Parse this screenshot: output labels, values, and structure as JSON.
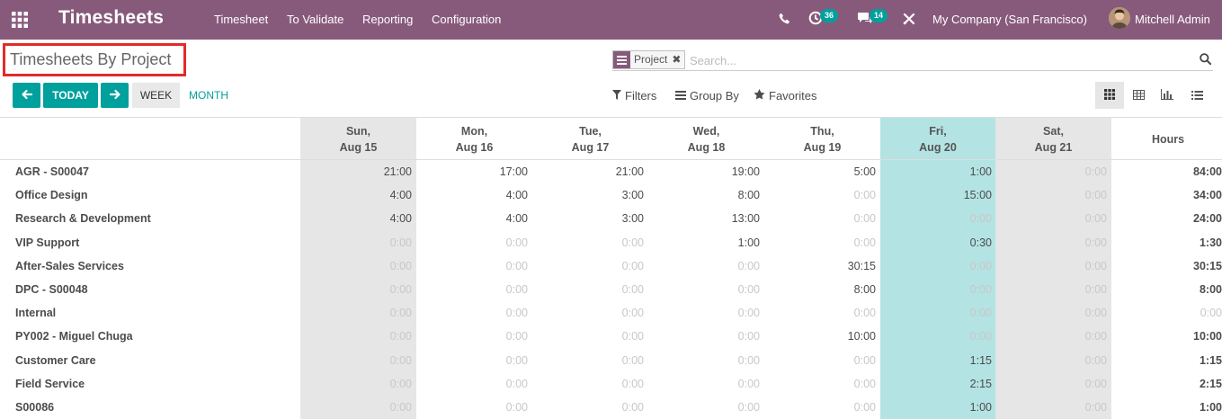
{
  "navbar": {
    "app_title": "Timesheets",
    "menus": [
      "Timesheet",
      "To Validate",
      "Reporting",
      "Configuration"
    ],
    "activity_count": "36",
    "message_count": "14",
    "company": "My Company (San Francisco)",
    "user": "Mitchell Admin",
    "color": "#875a7b"
  },
  "control_panel": {
    "title": "Timesheets By Project",
    "search": {
      "facet_label": "Project",
      "placeholder": "Search..."
    },
    "buttons": {
      "today": "TODAY",
      "week": "WEEK",
      "month": "MONTH"
    },
    "menus": {
      "filters": "Filters",
      "group_by": "Group By",
      "favorites": "Favorites"
    },
    "views": [
      "grid-icon",
      "pivot-icon",
      "graph-icon",
      "list-icon"
    ],
    "accent": "#00a09d"
  },
  "grid": {
    "columns": [
      {
        "day": "Sun,",
        "date": "Aug 15",
        "weekend": true
      },
      {
        "day": "Mon,",
        "date": "Aug 16",
        "weekend": false
      },
      {
        "day": "Tue,",
        "date": "Aug 17",
        "weekend": false
      },
      {
        "day": "Wed,",
        "date": "Aug 18",
        "weekend": false
      },
      {
        "day": "Thu,",
        "date": "Aug 19",
        "weekend": false
      },
      {
        "day": "Fri,",
        "date": "Aug 20",
        "today": true
      },
      {
        "day": "Sat,",
        "date": "Aug 21",
        "weekend": true
      }
    ],
    "total_header": "Hours",
    "rows": [
      {
        "label": "AGR - S00047",
        "values": [
          "21:00",
          "17:00",
          "21:00",
          "19:00",
          "5:00",
          "1:00",
          "0:00"
        ],
        "total": "84:00"
      },
      {
        "label": "Office Design",
        "values": [
          "4:00",
          "4:00",
          "3:00",
          "8:00",
          "0:00",
          "15:00",
          "0:00"
        ],
        "total": "34:00"
      },
      {
        "label": "Research & Development",
        "values": [
          "4:00",
          "4:00",
          "3:00",
          "13:00",
          "0:00",
          "0:00",
          "0:00"
        ],
        "total": "24:00"
      },
      {
        "label": "VIP Support",
        "values": [
          "0:00",
          "0:00",
          "0:00",
          "1:00",
          "0:00",
          "0:30",
          "0:00"
        ],
        "total": "1:30"
      },
      {
        "label": "After-Sales Services",
        "values": [
          "0:00",
          "0:00",
          "0:00",
          "0:00",
          "30:15",
          "0:00",
          "0:00"
        ],
        "total": "30:15"
      },
      {
        "label": "DPC - S00048",
        "values": [
          "0:00",
          "0:00",
          "0:00",
          "0:00",
          "8:00",
          "0:00",
          "0:00"
        ],
        "total": "8:00"
      },
      {
        "label": "Internal",
        "values": [
          "0:00",
          "0:00",
          "0:00",
          "0:00",
          "0:00",
          "0:00",
          "0:00"
        ],
        "total": "0:00"
      },
      {
        "label": "PY002 - Miguel Chuga",
        "values": [
          "0:00",
          "0:00",
          "0:00",
          "0:00",
          "10:00",
          "0:00",
          "0:00"
        ],
        "total": "10:00"
      },
      {
        "label": "Customer Care",
        "values": [
          "0:00",
          "0:00",
          "0:00",
          "0:00",
          "0:00",
          "1:15",
          "0:00"
        ],
        "total": "1:15"
      },
      {
        "label": "Field Service",
        "values": [
          "0:00",
          "0:00",
          "0:00",
          "0:00",
          "0:00",
          "2:15",
          "0:00"
        ],
        "total": "2:15"
      },
      {
        "label": "S00086",
        "values": [
          "0:00",
          "0:00",
          "0:00",
          "0:00",
          "0:00",
          "1:00",
          "0:00"
        ],
        "total": "1:00"
      }
    ],
    "colors": {
      "weekend": "#e6e6e6",
      "today": "#b3e3e2"
    }
  }
}
